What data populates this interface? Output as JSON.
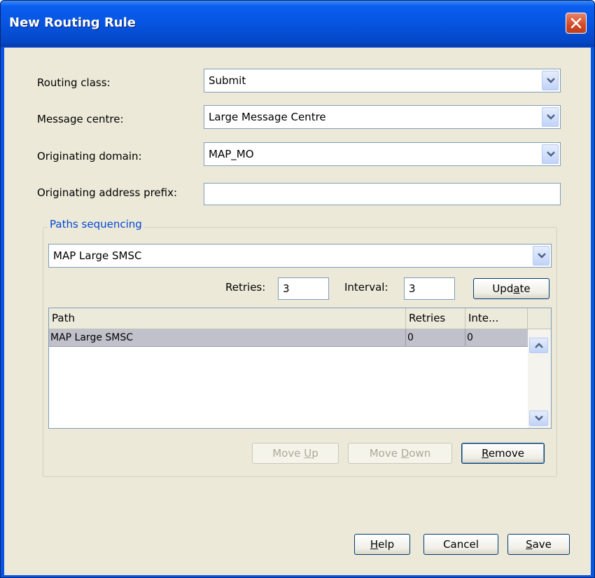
{
  "window": {
    "title": "New Routing Rule"
  },
  "form": {
    "routing_class": {
      "label": "Routing class:",
      "value": "Submit"
    },
    "message_centre": {
      "label": "Message centre:",
      "value": "Large Message Centre"
    },
    "originating_domain": {
      "label": "Originating domain:",
      "value": "MAP_MO"
    },
    "originating_prefix": {
      "label": "Originating address prefix:",
      "value": ""
    }
  },
  "paths": {
    "group_title": "Paths sequencing",
    "path_select": "MAP Large SMSC",
    "retries_label": "Retries:",
    "retries_value": "3",
    "interval_label": "Interval:",
    "interval_value": "3",
    "update_button": {
      "pre": "Upd",
      "mn": "a",
      "post": "te"
    },
    "table": {
      "columns": [
        "Path",
        "Retries",
        "Inte..."
      ],
      "rows": [
        {
          "path": "MAP Large SMSC",
          "retries": "0",
          "interval": "0"
        }
      ]
    },
    "move_up_button": {
      "pre": "Move ",
      "mn": "U",
      "post": "p"
    },
    "move_down_button": {
      "pre": "Move ",
      "mn": "D",
      "post": "own"
    },
    "remove_button": {
      "pre": "",
      "mn": "R",
      "post": "emove"
    }
  },
  "footer": {
    "help_button": {
      "pre": "",
      "mn": "H",
      "post": "elp"
    },
    "cancel_button": "Cancel",
    "save_button": {
      "pre": "",
      "mn": "S",
      "post": "ave"
    }
  },
  "colors": {
    "titlebar": "#0754e0",
    "client_bg": "#ece9d8",
    "group_title": "#0046d5",
    "selected_row": "#c1c1cb"
  },
  "icons": [
    "close-icon",
    "dropdown-arrow-icon",
    "scroll-up-icon",
    "scroll-down-icon"
  ]
}
